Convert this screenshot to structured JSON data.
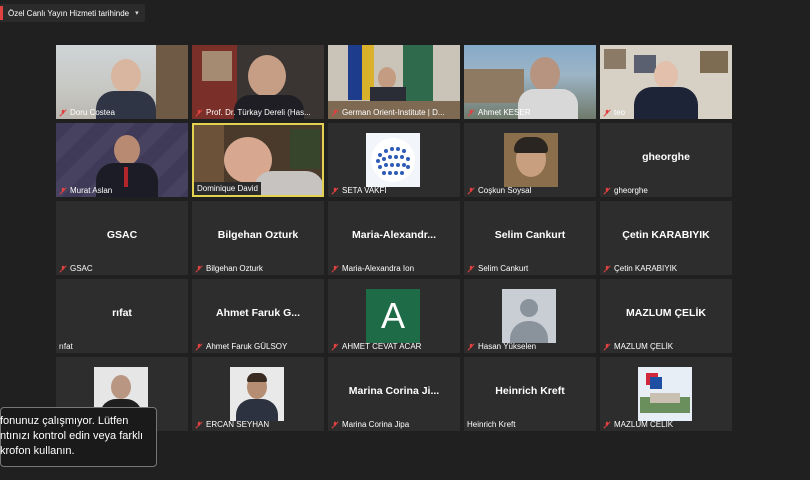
{
  "topbar": {
    "live_label": "Özel Canlı Yayın Hizmeti tarihinde"
  },
  "tiles": [
    {
      "name": "Doru Costea",
      "muted": true
    },
    {
      "name": "Prof. Dr. Türkay Dereli (Has...",
      "muted": true
    },
    {
      "name": "German Orient-Institute | D...",
      "muted": true
    },
    {
      "name": "Ahmet KESER",
      "muted": true
    },
    {
      "name": "teo",
      "muted": true
    },
    {
      "name": "Murat Aslan",
      "muted": true
    },
    {
      "name": "Dominique David",
      "muted": false,
      "active": true
    },
    {
      "name": "SETA VAKFI",
      "muted": true
    },
    {
      "name": "Coşkun Soysal",
      "muted": true
    },
    {
      "name": "gheorghe",
      "muted": true,
      "center": "gheorghe"
    },
    {
      "name": "GSAC",
      "muted": true,
      "center": "GSAC"
    },
    {
      "name": "Bilgehan Ozturk",
      "muted": true,
      "center": "Bilgehan Ozturk"
    },
    {
      "name": "Maria-Alexandra Ion",
      "muted": true,
      "center": "Maria-Alexandr..."
    },
    {
      "name": "Selim Cankurt",
      "muted": true,
      "center": "Selim Cankurt"
    },
    {
      "name": "Çetin KARABIYIK",
      "muted": true,
      "center": "Çetin KARABIYIK"
    },
    {
      "name": "rıfat",
      "muted": false,
      "center": "rıfat"
    },
    {
      "name": "Ahmet Faruk GÜLSOY",
      "muted": true,
      "center": "Ahmet Faruk G..."
    },
    {
      "name": "AHMET CEVAT ACAR",
      "muted": true
    },
    {
      "name": "Hasan Yükselen",
      "muted": true
    },
    {
      "name": "MAZLUM ÇELİK",
      "muted": true,
      "center": "MAZLUM ÇELİK"
    },
    {
      "name": "",
      "muted": false
    },
    {
      "name": "ERCAN SEYHAN",
      "muted": true
    },
    {
      "name": "Marina Corina Jipa",
      "muted": true,
      "center": "Marina Corina Ji..."
    },
    {
      "name": "Heinrich Kreft",
      "muted": false,
      "center": "Heinrich Kreft"
    },
    {
      "name": "MAZLUM CELIK",
      "muted": true
    }
  ],
  "toast": {
    "line1": "fonunuz çalışmıyor. Lütfen",
    "line2": "ntınızı kontrol edin veya farklı",
    "line3": "krofon kullanın."
  },
  "avatar_letter": "A",
  "colors": {
    "tile_bg": "#2d2d2d",
    "active_border": "#e2d24f",
    "mute_red": "#e04141",
    "acar_green": "#1e6b47"
  }
}
